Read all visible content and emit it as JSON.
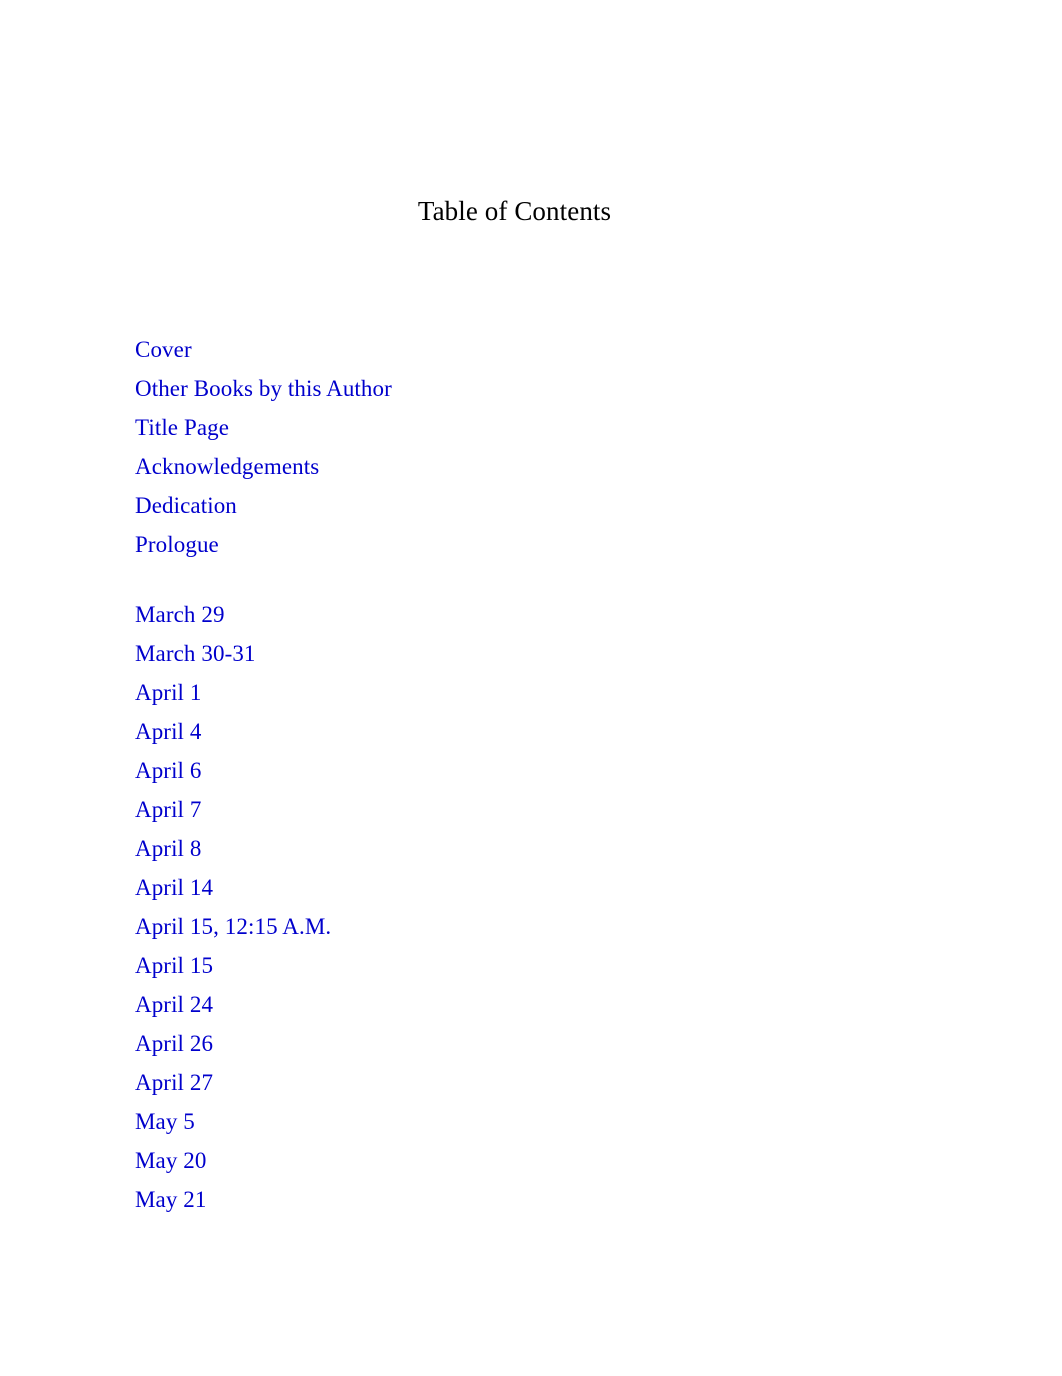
{
  "document": {
    "title": "Table of Contents",
    "background_color": "#ffffff",
    "title_color": "#000000",
    "link_color": "#0000cc"
  },
  "toc": {
    "heading": "Table of Contents",
    "groups": [
      {
        "name": "front-matter",
        "entries": [
          {
            "label": "Cover"
          },
          {
            "label": "Other Books by this Author"
          },
          {
            "label": "Title Page"
          },
          {
            "label": "Acknowledgements"
          },
          {
            "label": "Dedication"
          },
          {
            "label": "Prologue"
          }
        ]
      },
      {
        "name": "chapters-by-date",
        "entries": [
          {
            "label": "March 29"
          },
          {
            "label": "March 30-31"
          },
          {
            "label": "April 1"
          },
          {
            "label": "April 4"
          },
          {
            "label": "April 6"
          },
          {
            "label": "April 7"
          },
          {
            "label": "April 8"
          },
          {
            "label": "April 14"
          },
          {
            "label": "April 15, 12:15 A.M."
          },
          {
            "label": "April 15"
          },
          {
            "label": "April 24"
          },
          {
            "label": "April 26"
          },
          {
            "label": "April 27"
          },
          {
            "label": "May 5"
          },
          {
            "label": "May 20"
          },
          {
            "label": "May 21"
          }
        ]
      }
    ]
  }
}
